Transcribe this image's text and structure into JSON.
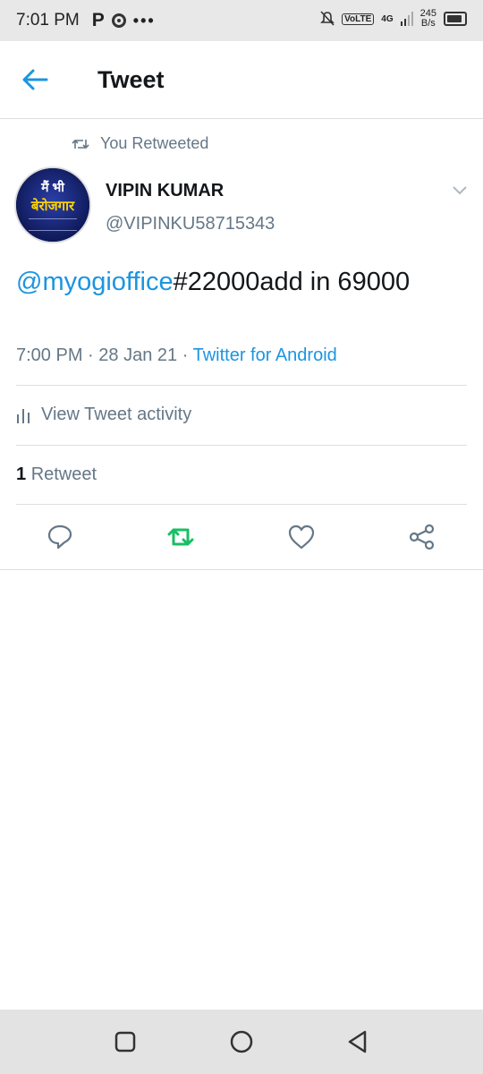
{
  "status_bar": {
    "time": "7:01 PM",
    "dots": "•••",
    "network": "4G",
    "volte": "VoLTE",
    "speed_value": "245",
    "speed_unit": "B/s"
  },
  "header": {
    "title": "Tweet"
  },
  "tweet": {
    "retweet_context": "You Retweeted",
    "author_name": "VIPIN KUMAR",
    "author_handle": "@VIPINKU58715343",
    "avatar_text_line1": "मैं भी",
    "avatar_text_line2": "बेरोजगार",
    "text_mention": "@myogioffice",
    "text_rest": "#22000add in 69000",
    "time": "7:00 PM",
    "date": "28 Jan 21",
    "source": "Twitter for Android",
    "separator": "·"
  },
  "activity": {
    "label": "View Tweet activity"
  },
  "stats": {
    "retweet_count": "1",
    "retweet_label": "Retweet"
  },
  "colors": {
    "accent": "#1b95e0",
    "retweet_active": "#17bf63",
    "muted": "#657786"
  }
}
